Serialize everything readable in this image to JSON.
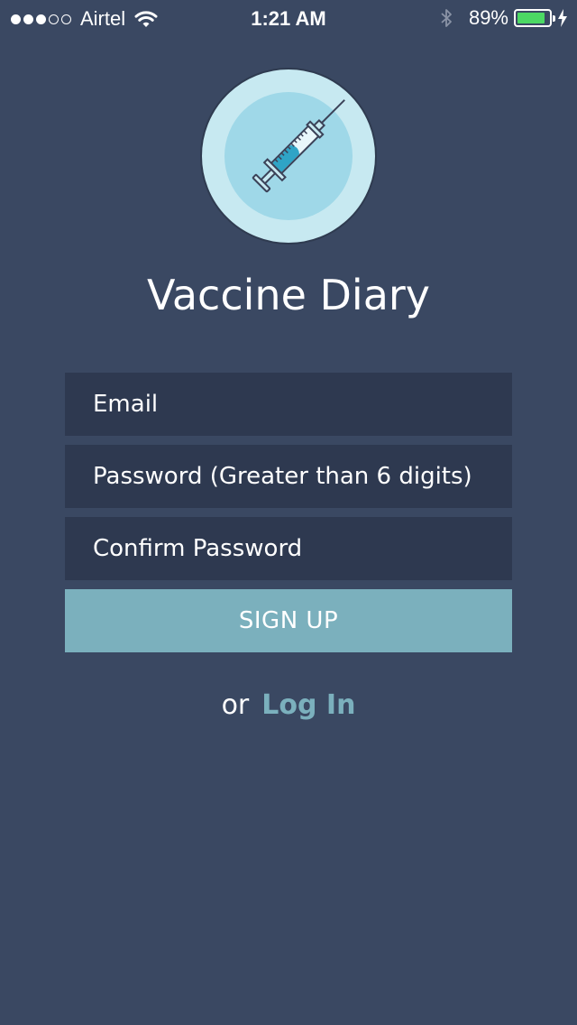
{
  "status_bar": {
    "signal_strength": "3 of 5",
    "carrier": "Airtel",
    "time": "1:21 AM",
    "battery_percent": "89%",
    "battery_level": 0.89,
    "icons": [
      "signal-dots-icon",
      "wifi-icon",
      "bluetooth-icon",
      "battery-icon",
      "charging-bolt-icon"
    ]
  },
  "app": {
    "logo_icon": "syringe-icon",
    "title": "Vaccine Diary"
  },
  "form": {
    "email_placeholder": "Email",
    "password_placeholder": "Password (Greater than 6 digits)",
    "confirm_placeholder": "Confirm Password",
    "signup_label": "SIGN UP"
  },
  "alt": {
    "or_text": "or",
    "login_label": "Log In"
  },
  "colors": {
    "background": "#3a4862",
    "field_background": "#2e3950",
    "accent": "#7bb0bd",
    "battery_green": "#4cd964"
  }
}
